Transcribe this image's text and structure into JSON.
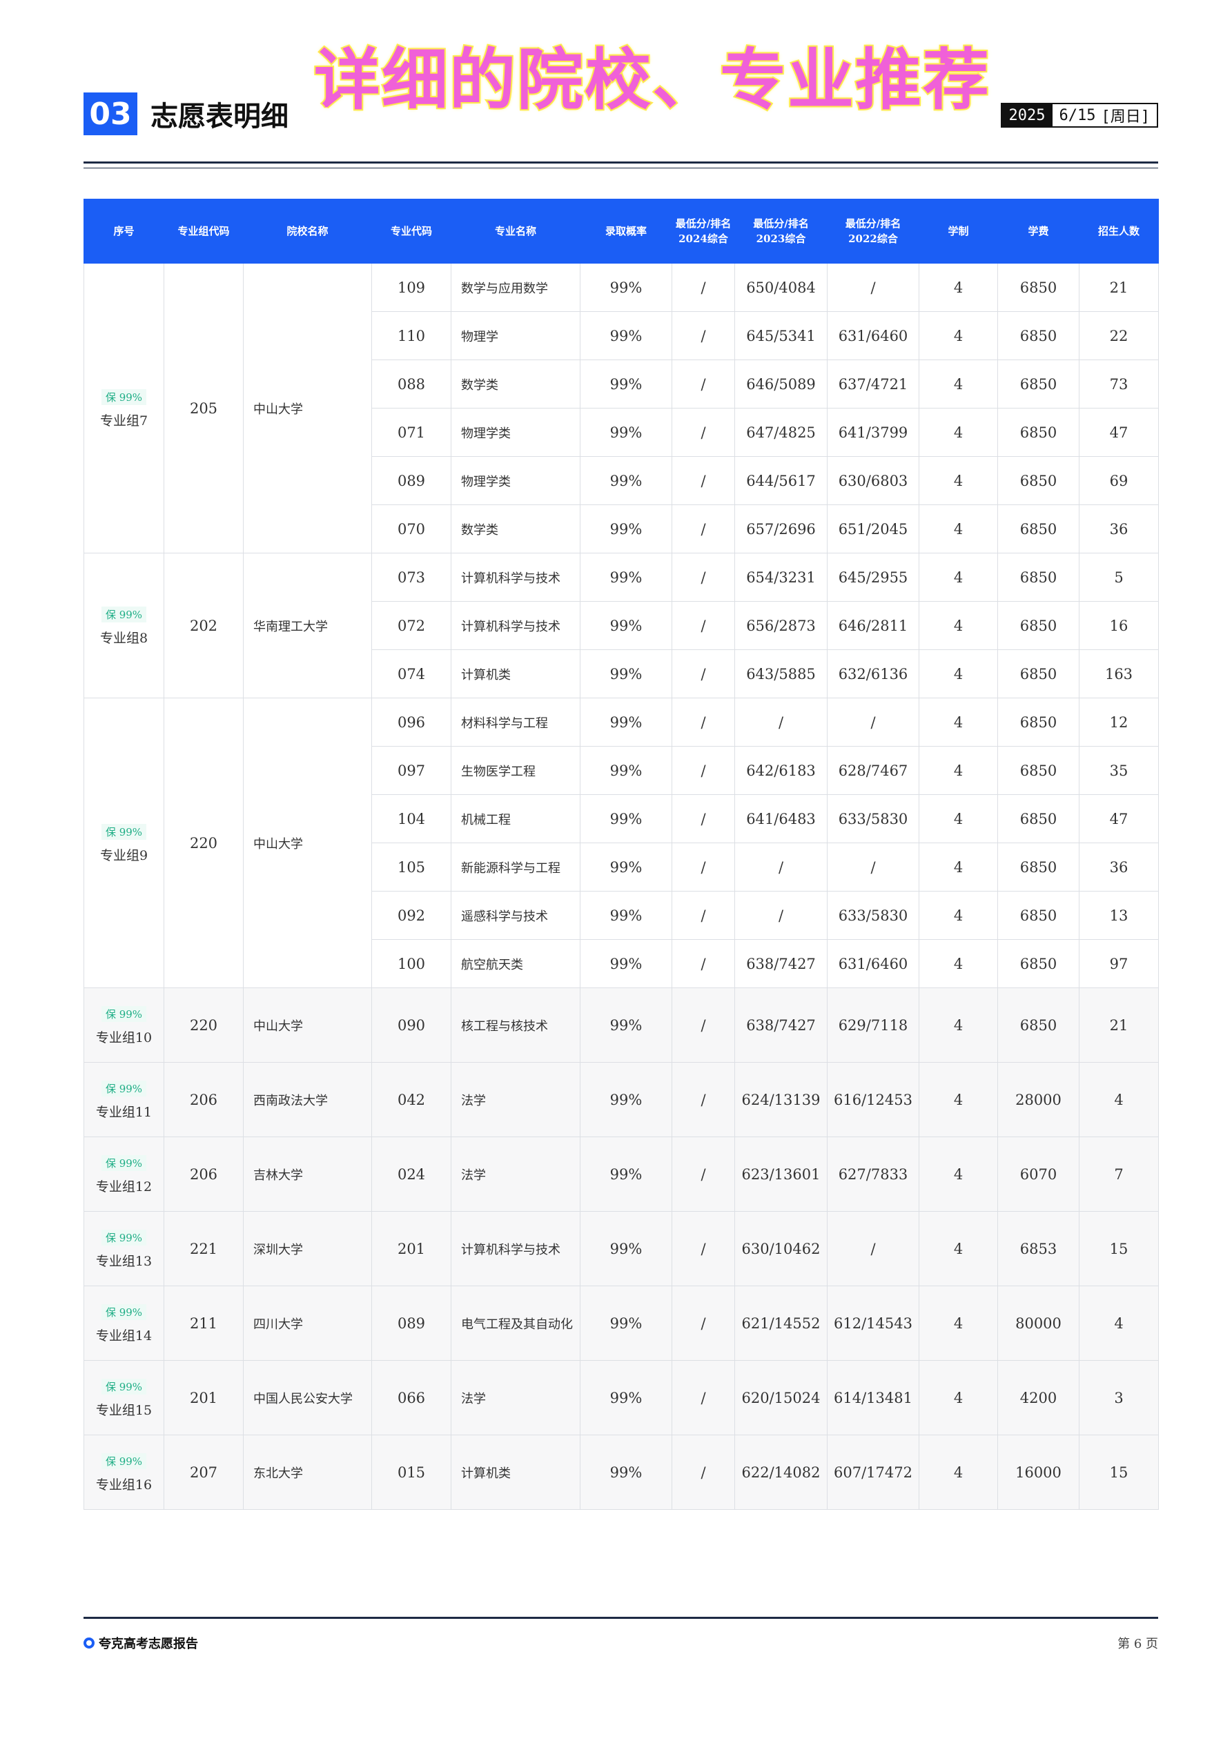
{
  "header": {
    "section_number": "03",
    "section_title": "志愿表明细",
    "overlay_title": "详细的院校、专业推荐",
    "year": "2025",
    "date": "6/15",
    "weekday": "[周日]"
  },
  "table": {
    "columns": [
      "序号",
      "专业组代码",
      "院校名称",
      "专业代码",
      "专业名称",
      "录取概率",
      "最低分/排名\n2024综合",
      "最低分/排名\n2023综合",
      "最低分/排名\n2022综合",
      "学制",
      "学费",
      "招生人数"
    ],
    "groups": [
      {
        "badge": "保 99%",
        "name": "专业组7",
        "code": "205",
        "school": "中山大学",
        "rows": [
          {
            "major_code": "109",
            "major": "数学与应用数学",
            "prob": "99%",
            "s2024": "/",
            "s2023": "650/4084",
            "s2022": "/",
            "years": "4",
            "fee": "6850",
            "count": "21"
          },
          {
            "major_code": "110",
            "major": "物理学",
            "prob": "99%",
            "s2024": "/",
            "s2023": "645/5341",
            "s2022": "631/6460",
            "years": "4",
            "fee": "6850",
            "count": "22"
          },
          {
            "major_code": "088",
            "major": "数学类",
            "prob": "99%",
            "s2024": "/",
            "s2023": "646/5089",
            "s2022": "637/4721",
            "years": "4",
            "fee": "6850",
            "count": "73"
          },
          {
            "major_code": "071",
            "major": "物理学类",
            "prob": "99%",
            "s2024": "/",
            "s2023": "647/4825",
            "s2022": "641/3799",
            "years": "4",
            "fee": "6850",
            "count": "47"
          },
          {
            "major_code": "089",
            "major": "物理学类",
            "prob": "99%",
            "s2024": "/",
            "s2023": "644/5617",
            "s2022": "630/6803",
            "years": "4",
            "fee": "6850",
            "count": "69"
          },
          {
            "major_code": "070",
            "major": "数学类",
            "prob": "99%",
            "s2024": "/",
            "s2023": "657/2696",
            "s2022": "651/2045",
            "years": "4",
            "fee": "6850",
            "count": "36"
          }
        ]
      },
      {
        "badge": "保 99%",
        "name": "专业组8",
        "code": "202",
        "school": "华南理工大学",
        "rows": [
          {
            "major_code": "073",
            "major": "计算机科学与技术",
            "prob": "99%",
            "s2024": "/",
            "s2023": "654/3231",
            "s2022": "645/2955",
            "years": "4",
            "fee": "6850",
            "count": "5"
          },
          {
            "major_code": "072",
            "major": "计算机科学与技术",
            "prob": "99%",
            "s2024": "/",
            "s2023": "656/2873",
            "s2022": "646/2811",
            "years": "4",
            "fee": "6850",
            "count": "16"
          },
          {
            "major_code": "074",
            "major": "计算机类",
            "prob": "99%",
            "s2024": "/",
            "s2023": "643/5885",
            "s2022": "632/6136",
            "years": "4",
            "fee": "6850",
            "count": "163"
          }
        ]
      },
      {
        "badge": "保 99%",
        "name": "专业组9",
        "code": "220",
        "school": "中山大学",
        "rows": [
          {
            "major_code": "096",
            "major": "材料科学与工程",
            "prob": "99%",
            "s2024": "/",
            "s2023": "/",
            "s2022": "/",
            "years": "4",
            "fee": "6850",
            "count": "12"
          },
          {
            "major_code": "097",
            "major": "生物医学工程",
            "prob": "99%",
            "s2024": "/",
            "s2023": "642/6183",
            "s2022": "628/7467",
            "years": "4",
            "fee": "6850",
            "count": "35"
          },
          {
            "major_code": "104",
            "major": "机械工程",
            "prob": "99%",
            "s2024": "/",
            "s2023": "641/6483",
            "s2022": "633/5830",
            "years": "4",
            "fee": "6850",
            "count": "47"
          },
          {
            "major_code": "105",
            "major": "新能源科学与工程",
            "prob": "99%",
            "s2024": "/",
            "s2023": "/",
            "s2022": "/",
            "years": "4",
            "fee": "6850",
            "count": "36"
          },
          {
            "major_code": "092",
            "major": "遥感科学与技术",
            "prob": "99%",
            "s2024": "/",
            "s2023": "/",
            "s2022": "633/5830",
            "years": "4",
            "fee": "6850",
            "count": "13"
          },
          {
            "major_code": "100",
            "major": "航空航天类",
            "prob": "99%",
            "s2024": "/",
            "s2023": "638/7427",
            "s2022": "631/6460",
            "years": "4",
            "fee": "6850",
            "count": "97"
          }
        ]
      },
      {
        "badge": "保 99%",
        "name": "专业组10",
        "code": "220",
        "school": "中山大学",
        "rows": [
          {
            "major_code": "090",
            "major": "核工程与核技术",
            "prob": "99%",
            "s2024": "/",
            "s2023": "638/7427",
            "s2022": "629/7118",
            "years": "4",
            "fee": "6850",
            "count": "21"
          }
        ]
      },
      {
        "badge": "保 99%",
        "name": "专业组11",
        "code": "206",
        "school": "西南政法大学",
        "rows": [
          {
            "major_code": "042",
            "major": "法学",
            "prob": "99%",
            "s2024": "/",
            "s2023": "624/13139",
            "s2022": "616/12453",
            "years": "4",
            "fee": "28000",
            "count": "4"
          }
        ]
      },
      {
        "badge": "保 99%",
        "name": "专业组12",
        "code": "206",
        "school": "吉林大学",
        "rows": [
          {
            "major_code": "024",
            "major": "法学",
            "prob": "99%",
            "s2024": "/",
            "s2023": "623/13601",
            "s2022": "627/7833",
            "years": "4",
            "fee": "6070",
            "count": "7"
          }
        ]
      },
      {
        "badge": "保 99%",
        "name": "专业组13",
        "code": "221",
        "school": "深圳大学",
        "rows": [
          {
            "major_code": "201",
            "major": "计算机科学与技术",
            "prob": "99%",
            "s2024": "/",
            "s2023": "630/10462",
            "s2022": "/",
            "years": "4",
            "fee": "6853",
            "count": "15"
          }
        ]
      },
      {
        "badge": "保 99%",
        "name": "专业组14",
        "code": "211",
        "school": "四川大学",
        "rows": [
          {
            "major_code": "089",
            "major": "电气工程及其自动化",
            "prob": "99%",
            "s2024": "/",
            "s2023": "621/14552",
            "s2022": "612/14543",
            "years": "4",
            "fee": "80000",
            "count": "4"
          }
        ]
      },
      {
        "badge": "保 99%",
        "name": "专业组15",
        "code": "201",
        "school": "中国人民公安大学",
        "rows": [
          {
            "major_code": "066",
            "major": "法学",
            "prob": "99%",
            "s2024": "/",
            "s2023": "620/15024",
            "s2022": "614/13481",
            "years": "4",
            "fee": "4200",
            "count": "3"
          }
        ]
      },
      {
        "badge": "保 99%",
        "name": "专业组16",
        "code": "207",
        "school": "东北大学",
        "rows": [
          {
            "major_code": "015",
            "major": "计算机类",
            "prob": "99%",
            "s2024": "/",
            "s2023": "622/14082",
            "s2022": "607/17472",
            "years": "4",
            "fee": "16000",
            "count": "15"
          }
        ]
      }
    ]
  },
  "footer": {
    "brand": "夸克高考志愿报告",
    "page": "第 6 页"
  }
}
